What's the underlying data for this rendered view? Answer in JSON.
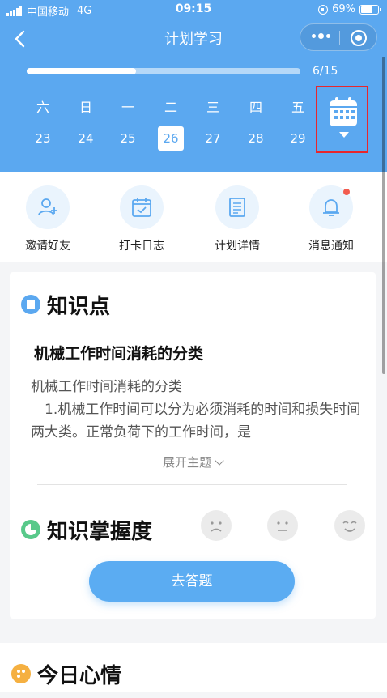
{
  "status_bar": {
    "carrier": "中国移动",
    "network": "4G",
    "time": "09:15",
    "battery": "69%"
  },
  "nav": {
    "title": "计划学习"
  },
  "progress": {
    "text": "6/15",
    "fraction": 0.4
  },
  "week": [
    {
      "weekday": "六",
      "date": "23",
      "active": false
    },
    {
      "weekday": "日",
      "date": "24",
      "active": false
    },
    {
      "weekday": "一",
      "date": "25",
      "active": false
    },
    {
      "weekday": "二",
      "date": "26",
      "active": true
    },
    {
      "weekday": "三",
      "date": "27",
      "active": false
    },
    {
      "weekday": "四",
      "date": "28",
      "active": false
    },
    {
      "weekday": "五",
      "date": "29",
      "active": false
    }
  ],
  "actions": [
    {
      "label": "邀请好友",
      "icon": "add-user-icon"
    },
    {
      "label": "打卡日志",
      "icon": "calendar-check-icon"
    },
    {
      "label": "计划详情",
      "icon": "document-icon"
    },
    {
      "label": "消息通知",
      "icon": "bell-icon"
    }
  ],
  "knowledge": {
    "title": "知识点",
    "subtitle": "机械工作时间消耗的分类",
    "body_line1": "机械工作时间消耗的分类",
    "body_line2": "1.机械工作时间可以分为必须消耗的时间和损失时间两大类。正常负荷下的工作时间，是",
    "expand_label": "展开主题"
  },
  "mastery": {
    "title": "知识掌握度",
    "button_label": "去答题"
  },
  "mood": {
    "title": "今日心情"
  },
  "colors": {
    "primary": "#5ba8f0",
    "highlight_box": "#e8262c",
    "badge": "#f25b4e"
  }
}
